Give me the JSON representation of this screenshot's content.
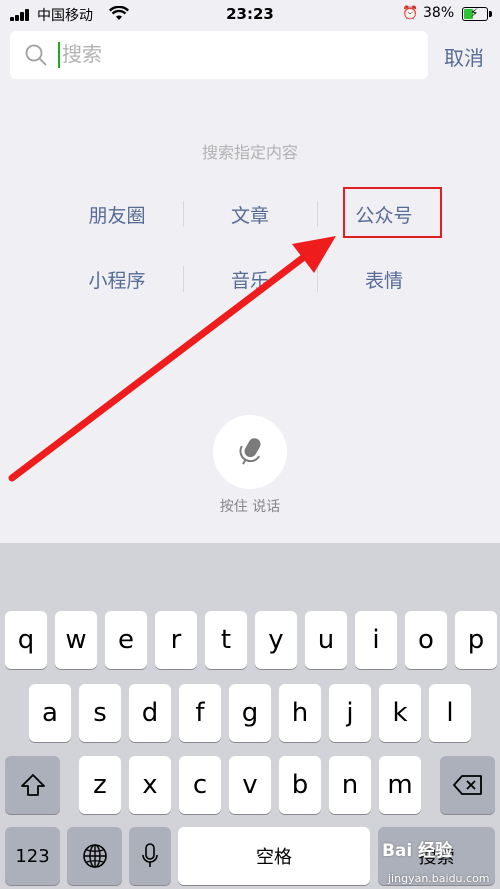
{
  "status_bar": {
    "carrier": "中国移动",
    "time": "23:23",
    "battery_percent": "38%",
    "icons": [
      "signal-icon",
      "wifi-icon",
      "alarm-icon",
      "battery-charging-icon"
    ]
  },
  "search": {
    "placeholder": "搜索",
    "value": "",
    "cancel_label": "取消"
  },
  "search_scope": {
    "title": "搜索指定内容",
    "categories": [
      "朋友圈",
      "文章",
      "公众号",
      "小程序",
      "音乐",
      "表情"
    ],
    "highlighted": "公众号"
  },
  "voice": {
    "hint": "按住 说话"
  },
  "keyboard": {
    "row1": [
      "q",
      "w",
      "e",
      "r",
      "t",
      "y",
      "u",
      "i",
      "o",
      "p"
    ],
    "row2": [
      "a",
      "s",
      "d",
      "f",
      "g",
      "h",
      "j",
      "k",
      "l"
    ],
    "row3": [
      "z",
      "x",
      "c",
      "v",
      "b",
      "n",
      "m"
    ],
    "numbers_label": "123",
    "space_label": "空格",
    "search_label": "搜索"
  },
  "watermark": {
    "logo_text": "Bai 经验",
    "site": "jingyan.baidu.com"
  },
  "colors": {
    "link": "#576b95",
    "annotation_red": "#e02020",
    "caret_green": "#1aad19",
    "battery_green": "#30c236"
  }
}
